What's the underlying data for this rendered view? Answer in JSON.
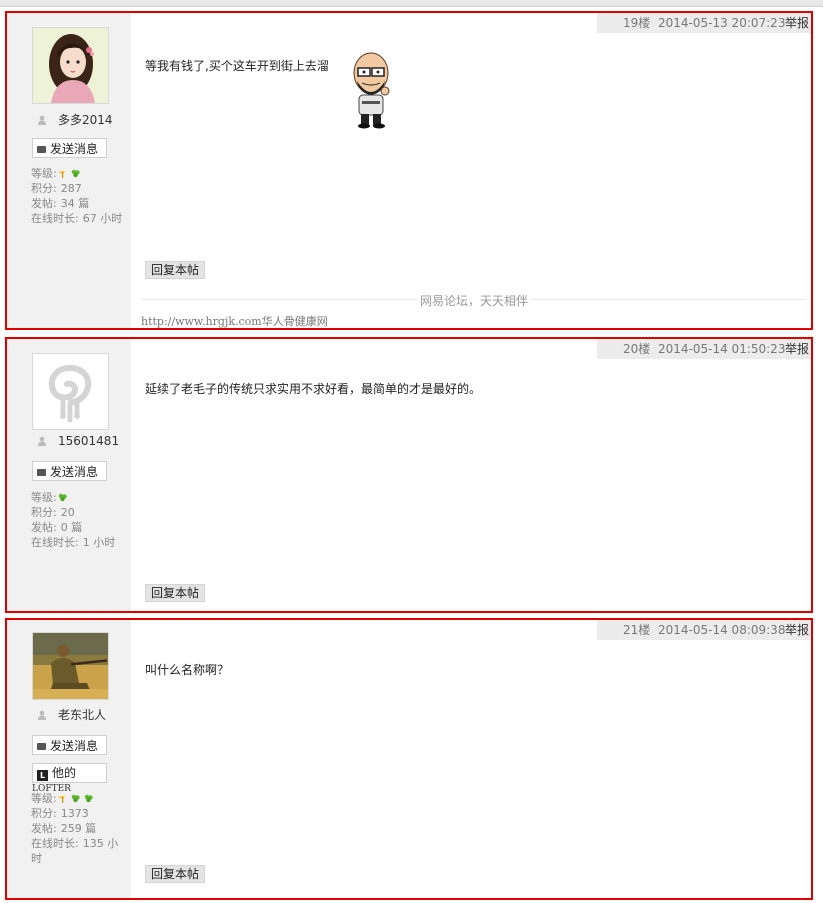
{
  "ui": {
    "send_message_label": "发送消息",
    "reply_label": "回复本帖",
    "report_label": "举报",
    "level_label": "等级:",
    "points_label": "积分:",
    "posts_label": "发帖:",
    "posts_unit": "篇",
    "online_label": "在线时长:",
    "online_unit": "小时",
    "lofter_label": "他的",
    "lofter_word": "LOFTER"
  },
  "posts": [
    {
      "floor": "19楼",
      "datetime": "2014-05-13 20:07:23",
      "username": "多多2014",
      "avatar": "anime-girl-avatar",
      "level_icons": [
        "level-sprout-icon",
        "level-clover-icon"
      ],
      "points": "287",
      "post_count": "34",
      "online_hours": "67",
      "content": "等我有钱了,买个这车开到街上去溜",
      "emoticon": "thinking-bald-man-emoticon",
      "signature": {
        "slogan": "网易论坛，天天相伴",
        "url": "http://www.hrgjk.com",
        "site_name": "华人骨健康网"
      }
    },
    {
      "floor": "20楼",
      "datetime": "2014-05-14 01:50:23",
      "username": "15601481",
      "avatar": "default-swirl-avatar",
      "level_icons": [
        "level-clover-icon"
      ],
      "points": "20",
      "post_count": "0",
      "online_hours": "1",
      "content": "延续了老毛子的传统只求实用不求好看，最简单的才是最好的。"
    },
    {
      "floor": "21楼",
      "datetime": "2014-05-14 08:09:38",
      "username": "老东北人",
      "avatar": "soldier-photo-avatar",
      "level_icons": [
        "level-sprout-icon",
        "level-clover-icon",
        "level-clover-icon"
      ],
      "points": "1373",
      "post_count": "259",
      "online_hours": "135",
      "content": "叫什么名称啊？"
    }
  ],
  "colors": {
    "highlight_border": "#e00000",
    "sidebar_bg": "#f1f1f1",
    "header_bg": "#ececec"
  }
}
